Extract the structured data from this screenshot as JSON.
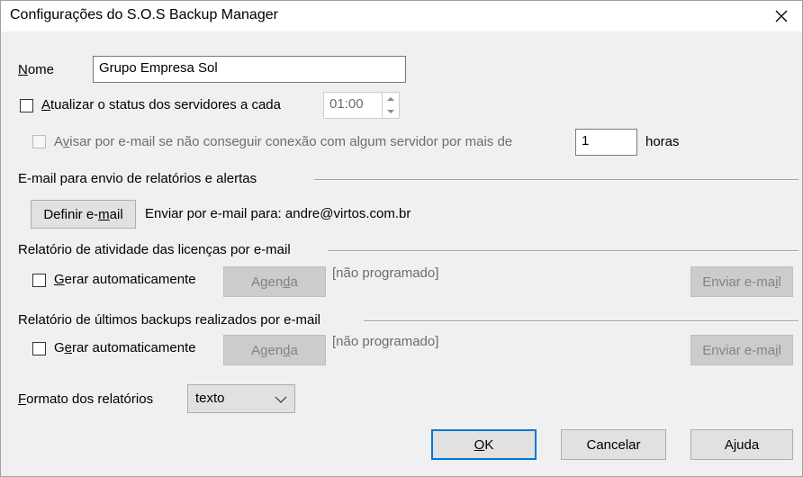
{
  "window": {
    "title": "Configurações do S.O.S Backup Manager",
    "close_icon": "close-icon"
  },
  "nome": {
    "label_before": "",
    "label_mnemonic": "N",
    "label_after": "ome",
    "value": "Grupo Empresa Sol"
  },
  "atualizar": {
    "label_mnemonic": "A",
    "label_after": "tualizar o status dos servidores a cada",
    "checked": false,
    "time_value": "01:00"
  },
  "avisar": {
    "label_mnemonic": "v",
    "label_before": "A",
    "label_after": "isar por e-mail se não conseguir conexão com algum servidor por mais de",
    "checked": false,
    "enabled": false,
    "hours_value": "1",
    "hours_unit": "horas"
  },
  "email_section": {
    "title": "E-mail para envio de relatórios e alertas",
    "define_button_before": "Definir e-",
    "define_button_mnemonic": "m",
    "define_button_after": "ail",
    "send_text": "Enviar por e-mail para: andre@virtos.com.br"
  },
  "licencas_section": {
    "title": "Relatório de atividade das licenças por e-mail",
    "auto_mnemonic": "G",
    "auto_after": "erar automaticamente",
    "agenda_before": "Agen",
    "agenda_mnemonic": "d",
    "agenda_after": "a",
    "status": "[não programado]",
    "send_before": "Enviar e-ma",
    "send_mnemonic": "i",
    "send_after": "l"
  },
  "backups_section": {
    "title": "Relatório de últimos backups realizados por e-mail",
    "auto_before": "G",
    "auto_mnemonic": "e",
    "auto_after": "rar automaticamente",
    "agenda_before": "Agen",
    "agenda_mnemonic": "d",
    "agenda_after": "a",
    "status": "[não programado]",
    "send_before": "Enviar e-ma",
    "send_mnemonic": "i",
    "send_after": "l"
  },
  "formato": {
    "label_mnemonic": "F",
    "label_after": "ormato dos relatórios",
    "selected": "texto"
  },
  "buttons": {
    "ok_before": "",
    "ok_mnemonic": "O",
    "ok_after": "K",
    "cancel": "Cancelar",
    "help": "Ajuda"
  }
}
